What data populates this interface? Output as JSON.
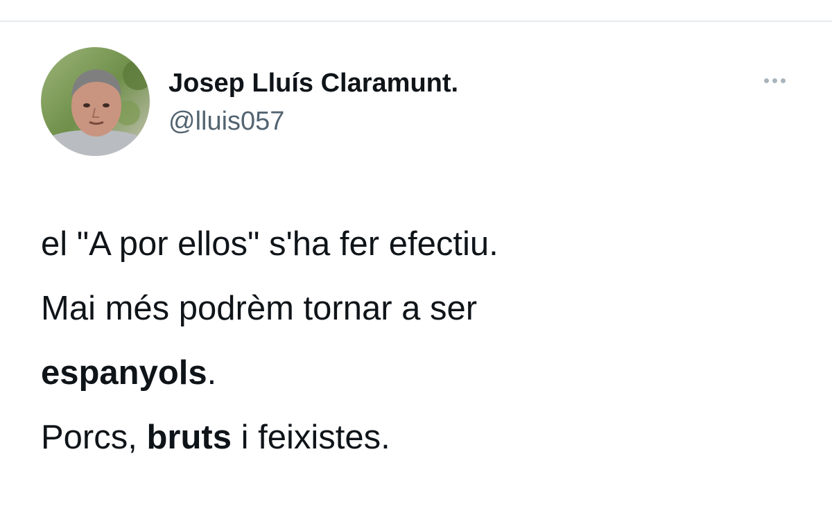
{
  "tweet": {
    "author": {
      "display_name": "Josep Lluís Claramunt.",
      "handle": "@lluis057",
      "avatar_icon": "user-avatar-photo"
    },
    "more_icon": "more-options-icon",
    "text": {
      "line1": "el \"A por ellos\" s'ha fer efectiu.",
      "line2": "Mai més podrèm tornar a ser",
      "line3_bold": "espanyols",
      "line3_rest": ".",
      "line4_start": "Porcs, ",
      "line4_bold": "bruts",
      "line4_end": " i feixistes."
    }
  },
  "colors": {
    "text": "#0f1419",
    "secondary": "#536471",
    "divider": "#cfd9de",
    "more_dots": "#a9b4bc"
  }
}
